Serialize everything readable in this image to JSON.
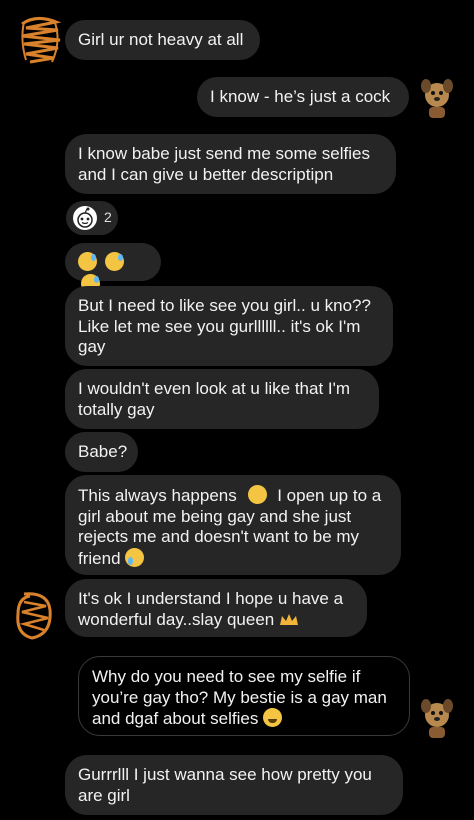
{
  "messages": [
    {
      "id": "m1",
      "text": "Girl ur not heavy at all"
    },
    {
      "id": "m2",
      "text": "I know - he’s just a cock"
    },
    {
      "id": "m3",
      "text": "I know babe just send me some selfies\nand I can give u better descriptipn"
    },
    {
      "id": "m5",
      "text": "But I need to like see you girl.. u kno??\nLike let me see you gurllllll.. it's ok I'm\ngay"
    },
    {
      "id": "m6",
      "text": "I wouldn't even look at u like that I'm\ntotally gay"
    },
    {
      "id": "m7",
      "text": "Babe?"
    },
    {
      "id": "m8a",
      "text": "This always happens"
    },
    {
      "id": "m8b",
      "text": "I open up to a"
    },
    {
      "id": "m8c",
      "text": "girl about me being gay and she just\nrejects me and doesn't want to be my\nfriend"
    },
    {
      "id": "m9a",
      "text": "It's ok I understand I hope u have a"
    },
    {
      "id": "m9b",
      "text": "wonderful day..slay queen"
    },
    {
      "id": "m10",
      "text": "Why do you need to see my selfie if\nyou’re gay tho? My bestie is a gay man\nand dgaf about selfies"
    },
    {
      "id": "m11",
      "text": "Gurrrlll  I just wanna see how pretty you\nare girl"
    }
  ],
  "reaction": {
    "count": "2",
    "icon": "reddit-face-icon"
  },
  "emoji_row": [
    "sweat-smile-icon",
    "sweat-smile-icon",
    "sweat-smile-icon"
  ],
  "colors": {
    "incoming_bubble": "#262626",
    "outgoing_outline": "#3a3a3a",
    "background": "#000000",
    "scribble": "#d9822b"
  }
}
